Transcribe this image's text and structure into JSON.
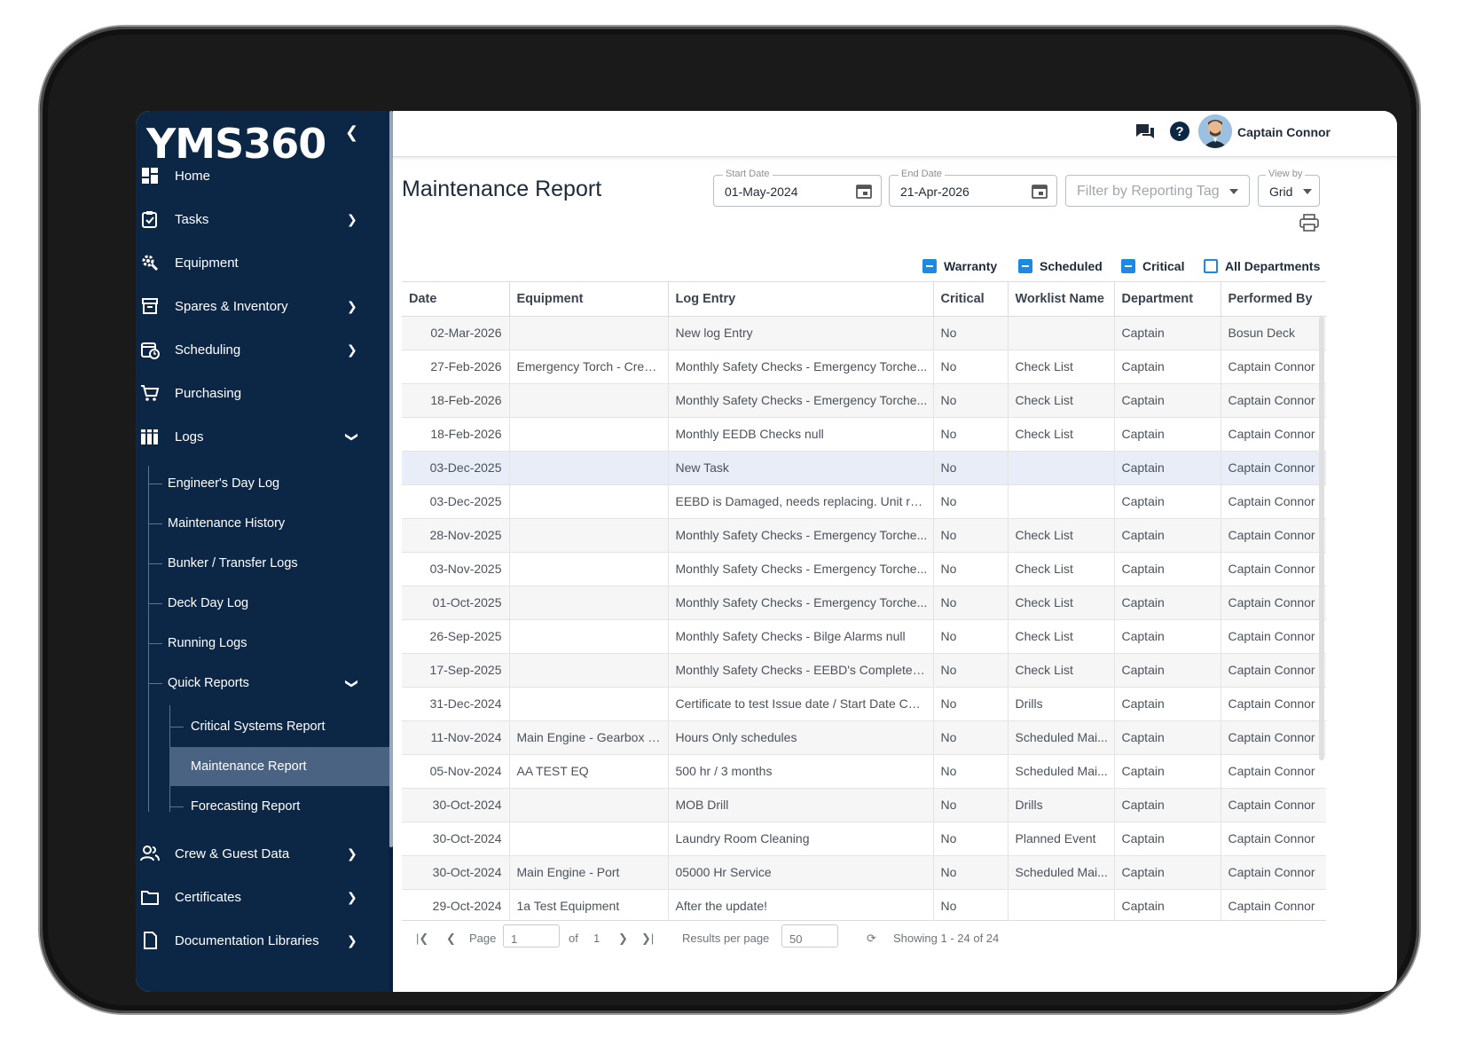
{
  "sidebar": {
    "logo": "YMS360",
    "items": [
      {
        "label": "Home"
      },
      {
        "label": "Tasks"
      },
      {
        "label": "Equipment"
      },
      {
        "label": "Spares & Inventory"
      },
      {
        "label": "Scheduling"
      },
      {
        "label": "Purchasing"
      },
      {
        "label": "Logs"
      },
      {
        "label": "Crew & Guest Data"
      },
      {
        "label": "Certificates"
      },
      {
        "label": "Documentation Libraries"
      }
    ],
    "logs_sub": [
      {
        "label": "Engineer's Day Log"
      },
      {
        "label": "Maintenance History"
      },
      {
        "label": "Bunker / Transfer Logs"
      },
      {
        "label": "Deck Day Log"
      },
      {
        "label": "Running Logs"
      },
      {
        "label": "Quick Reports"
      }
    ],
    "quick_reports_sub": [
      {
        "label": "Critical Systems Report"
      },
      {
        "label": "Maintenance Report",
        "active": true
      },
      {
        "label": "Forecasting Report"
      }
    ]
  },
  "topbar": {
    "user_name": "Captain Connor"
  },
  "page": {
    "title": "Maintenance Report",
    "start_date": {
      "label": "Start Date",
      "value": "01-May-2024"
    },
    "end_date": {
      "label": "End Date",
      "value": "21-Apr-2026"
    },
    "reporting_tag": {
      "placeholder": "Filter by Reporting Tag"
    },
    "view_by": {
      "label": "View by",
      "value": "Grid"
    }
  },
  "filters": [
    {
      "label": "Warranty",
      "state": "indeterminate"
    },
    {
      "label": "Scheduled",
      "state": "indeterminate"
    },
    {
      "label": "Critical",
      "state": "indeterminate"
    },
    {
      "label": "All Departments",
      "state": "unchecked"
    }
  ],
  "table": {
    "columns": [
      "Date",
      "Equipment",
      "Log Entry",
      "Critical",
      "Worklist Name",
      "Department",
      "Performed By"
    ],
    "rows": [
      [
        "02-Mar-2026",
        "",
        "New log Entry",
        "No",
        "",
        "Captain",
        "Bosun Deck"
      ],
      [
        "27-Feb-2026",
        "Emergency Torch - Crew...",
        "Monthly Safety Checks - Emergency Torche...",
        "No",
        "Check List",
        "Captain",
        "Captain Connor"
      ],
      [
        "18-Feb-2026",
        "",
        "Monthly Safety Checks - Emergency Torche...",
        "No",
        "Check List",
        "Captain",
        "Captain Connor"
      ],
      [
        "18-Feb-2026",
        "",
        "Monthly EEDB Checks null",
        "No",
        "Check List",
        "Captain",
        "Captain Connor"
      ],
      [
        "03-Dec-2025",
        "",
        "New Task",
        "No",
        "",
        "Captain",
        "Captain Connor"
      ],
      [
        "03-Dec-2025",
        "",
        "EEBD is Damaged, needs replacing. Unit rec...",
        "No",
        "",
        "Captain",
        "Captain Connor"
      ],
      [
        "28-Nov-2025",
        "",
        "Monthly Safety Checks - Emergency Torche...",
        "No",
        "Check List",
        "Captain",
        "Captain Connor"
      ],
      [
        "03-Nov-2025",
        "",
        "Monthly Safety Checks - Emergency Torche...",
        "No",
        "Check List",
        "Captain",
        "Captain Connor"
      ],
      [
        "01-Oct-2025",
        "",
        "Monthly Safety Checks - Emergency Torche...",
        "No",
        "Check List",
        "Captain",
        "Captain Connor"
      ],
      [
        "26-Sep-2025",
        "",
        "Monthly Safety Checks - Bilge Alarms null",
        "No",
        "Check List",
        "Captain",
        "Captain Connor"
      ],
      [
        "17-Sep-2025",
        "",
        "Monthly Safety Checks - EEBD's Completed ...",
        "No",
        "Check List",
        "Captain",
        "Captain Connor"
      ],
      [
        "31-Dec-2024",
        "",
        "Certificate to test Issue date / Start Date Cer...",
        "No",
        "Drills",
        "Captain",
        "Captain Connor"
      ],
      [
        "11-Nov-2024",
        "Main Engine - Gearbox - ...",
        "Hours Only schedules",
        "No",
        "Scheduled Mai...",
        "Captain",
        "Captain Connor"
      ],
      [
        "05-Nov-2024",
        "AA TEST EQ",
        "500 hr / 3 months",
        "No",
        "Scheduled Mai...",
        "Captain",
        "Captain Connor"
      ],
      [
        "30-Oct-2024",
        "",
        "MOB Drill",
        "No",
        "Drills",
        "Captain",
        "Captain Connor"
      ],
      [
        "30-Oct-2024",
        "",
        "Laundry Room Cleaning",
        "No",
        "Planned Event",
        "Captain",
        "Captain Connor"
      ],
      [
        "30-Oct-2024",
        "Main Engine - Port",
        "05000 Hr Service",
        "No",
        "Scheduled Mai...",
        "Captain",
        "Captain Connor"
      ],
      [
        "29-Oct-2024",
        "1a Test Equipment",
        "After the update!",
        "No",
        "",
        "Captain",
        "Captain Connor"
      ]
    ],
    "selected_row": 4
  },
  "pager": {
    "page_label": "Page",
    "page_value": "1",
    "of_label": "of",
    "total_pages": "1",
    "results_label": "Results per page",
    "results_value": "50",
    "showing": "Showing 1 - 24 of 24"
  },
  "colors": {
    "sidebar_bg": "#0c2745",
    "active_item_bg": "#4a6382",
    "checkbox_accent": "#1e88e5"
  }
}
